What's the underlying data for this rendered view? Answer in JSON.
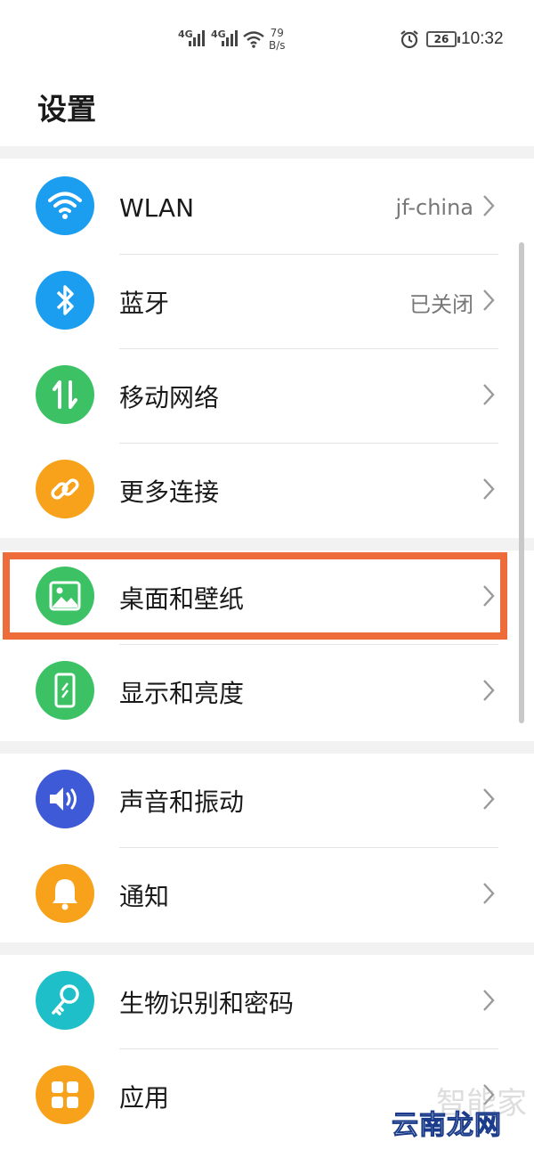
{
  "status_bar": {
    "signal1": "4G",
    "signal2": "4G",
    "speed_value": "79",
    "speed_unit": "B/s",
    "battery": "26",
    "time": "10:32"
  },
  "page": {
    "title": "设置"
  },
  "groups": [
    {
      "items": [
        {
          "label": "WLAN",
          "value": "jf-china",
          "icon": "wifi-icon",
          "color": "#1b9df0"
        },
        {
          "label": "蓝牙",
          "value": "已关闭",
          "icon": "bluetooth-icon",
          "color": "#1b9df0"
        },
        {
          "label": "移动网络",
          "value": "",
          "icon": "mobile-network-icon",
          "color": "#3cc265"
        },
        {
          "label": "更多连接",
          "value": "",
          "icon": "link-icon",
          "color": "#f8a11a"
        }
      ]
    },
    {
      "items": [
        {
          "label": "桌面和壁纸",
          "value": "",
          "icon": "image-icon",
          "color": "#3cc265"
        },
        {
          "label": "显示和亮度",
          "value": "",
          "icon": "phone-brightness-icon",
          "color": "#3cc265"
        }
      ]
    },
    {
      "items": [
        {
          "label": "声音和振动",
          "value": "",
          "icon": "speaker-icon",
          "color": "#3f5ad6"
        },
        {
          "label": "通知",
          "value": "",
          "icon": "bell-icon",
          "color": "#f8a11a"
        }
      ]
    },
    {
      "items": [
        {
          "label": "生物识别和密码",
          "value": "",
          "icon": "key-icon",
          "color": "#1fbfc9"
        },
        {
          "label": "应用",
          "value": "",
          "icon": "apps-grid-icon",
          "color": "#f8a11a"
        }
      ]
    }
  ],
  "highlight_color": "#ee6c3a",
  "watermark": {
    "text": "云南龙网",
    "faint": "智能家"
  }
}
